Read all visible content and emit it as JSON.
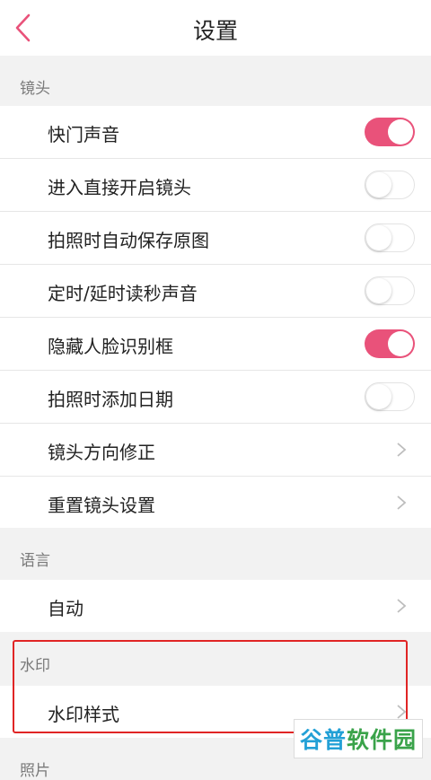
{
  "header": {
    "title": "设置"
  },
  "sections": [
    {
      "label": "镜头",
      "items": [
        {
          "label": "快门声音",
          "type": "toggle",
          "state": "on"
        },
        {
          "label": "进入直接开启镜头",
          "type": "toggle",
          "state": "off"
        },
        {
          "label": "拍照时自动保存原图",
          "type": "toggle",
          "state": "off"
        },
        {
          "label": "定时/延时读秒声音",
          "type": "toggle",
          "state": "off"
        },
        {
          "label": "隐藏人脸识别框",
          "type": "toggle",
          "state": "on"
        },
        {
          "label": "拍照时添加日期",
          "type": "toggle",
          "state": "off"
        },
        {
          "label": "镜头方向修正",
          "type": "link"
        },
        {
          "label": "重置镜头设置",
          "type": "link"
        }
      ]
    },
    {
      "label": "语言",
      "items": [
        {
          "label": "自动",
          "type": "link"
        }
      ]
    },
    {
      "label": "水印",
      "items": [
        {
          "label": "水印样式",
          "type": "link"
        }
      ]
    },
    {
      "label": "照片"
    }
  ],
  "watermark": {
    "part1": "谷普",
    "part2": "软件园"
  },
  "colors": {
    "accent": "#e9527a",
    "highlight": "#e02525"
  }
}
